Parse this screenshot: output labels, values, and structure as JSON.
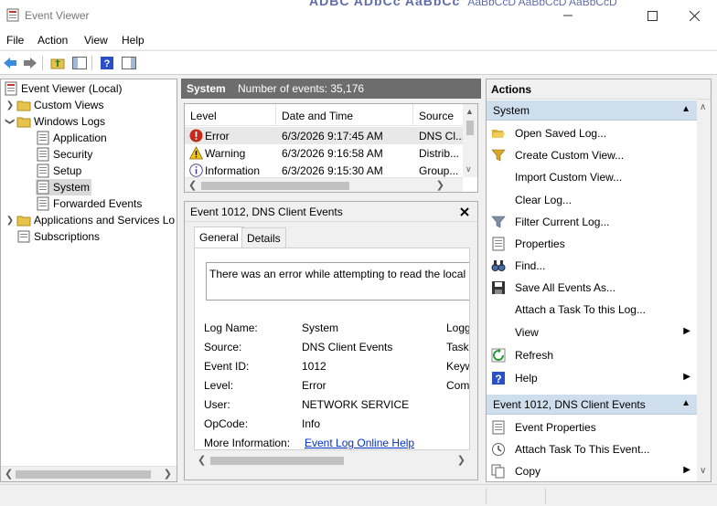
{
  "window": {
    "title": "Event Viewer",
    "background_peek": "ADBC  ADbCc  AaBbCc",
    "background_peek_small": "AaBbCcD   AaBbCcD   AaBbCcD"
  },
  "menu": [
    "File",
    "Action",
    "View",
    "Help"
  ],
  "tree": {
    "root": "Event Viewer (Local)",
    "custom_views": "Custom Views",
    "windows_logs": "Windows Logs",
    "logs": [
      "Application",
      "Security",
      "Setup",
      "System",
      "Forwarded Events"
    ],
    "selected": "System",
    "apps_services": "Applications and Services Lo",
    "subscriptions": "Subscriptions"
  },
  "log_header": {
    "name": "System",
    "count_label": "Number of events: 35,176"
  },
  "events": {
    "columns": [
      "Level",
      "Date and Time",
      "Source"
    ],
    "rows": [
      {
        "level": "Error",
        "datetime": "6/3/2026 9:17:45 AM",
        "source": "DNS Cl..."
      },
      {
        "level": "Warning",
        "datetime": "6/3/2026 9:16:58 AM",
        "source": "Distrib..."
      },
      {
        "level": "Information",
        "datetime": "6/3/2026 9:15:30 AM",
        "source": "Group..."
      }
    ]
  },
  "detail": {
    "title": "Event 1012, DNS Client Events",
    "tabs": [
      "General",
      "Details"
    ],
    "description": "There was an error while attempting to read the local h",
    "fields": {
      "log_name_label": "Log Name:",
      "log_name": "System",
      "source_label": "Source:",
      "source": "DNS Client Events",
      "event_id_label": "Event ID:",
      "event_id": "1012",
      "level_label": "Level:",
      "level": "Error",
      "user_label": "User:",
      "user": "NETWORK SERVICE",
      "opcode_label": "OpCode:",
      "opcode": "Info",
      "more_info_label": "More Information:",
      "more_info_link": "Event Log Online Help"
    },
    "right_col": [
      "Logg",
      "Task",
      "Keyw",
      "Com"
    ]
  },
  "actions": {
    "title": "Actions",
    "section1": "System",
    "items1": [
      {
        "label": "Open Saved Log...",
        "icon": "folder-icon"
      },
      {
        "label": "Create Custom View...",
        "icon": "filter-icon"
      },
      {
        "label": "Import Custom View...",
        "icon": ""
      },
      {
        "label": "Clear Log...",
        "icon": ""
      },
      {
        "label": "Filter Current Log...",
        "icon": "filter-icon"
      },
      {
        "label": "Properties",
        "icon": "properties-icon"
      },
      {
        "label": "Find...",
        "icon": "binoculars-icon"
      },
      {
        "label": "Save All Events As...",
        "icon": "save-icon"
      },
      {
        "label": "Attach a Task To this Log...",
        "icon": ""
      },
      {
        "label": "View",
        "icon": "",
        "submenu": true
      },
      {
        "label": "Refresh",
        "icon": "refresh-icon"
      },
      {
        "label": "Help",
        "icon": "help-icon",
        "submenu": true
      }
    ],
    "section2": "Event 1012, DNS Client Events",
    "items2": [
      {
        "label": "Event Properties",
        "icon": "properties-icon"
      },
      {
        "label": "Attach Task To This Event...",
        "icon": "task-icon"
      },
      {
        "label": "Copy",
        "icon": "copy-icon",
        "submenu": true
      }
    ]
  }
}
